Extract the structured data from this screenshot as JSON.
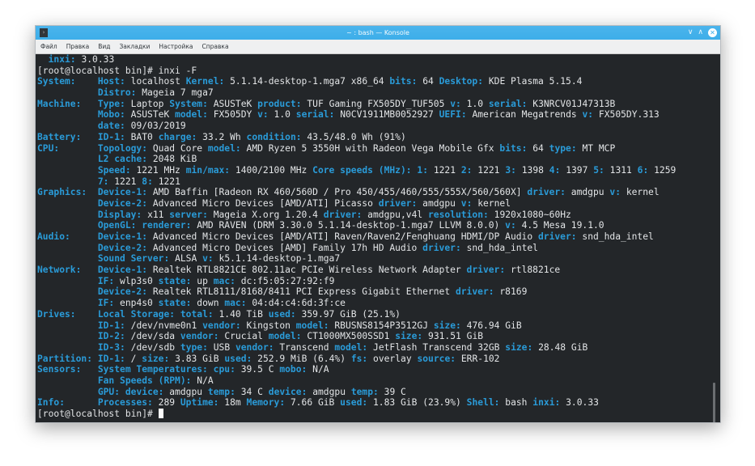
{
  "window": {
    "title": "~ : bash — Konsole",
    "app_icon": "terminal-icon"
  },
  "titlebar_buttons": {
    "minimize": "∨",
    "maximize": "∧",
    "close": "✕"
  },
  "menu": [
    "Файл",
    "Правка",
    "Вид",
    "Закладки",
    "Настройка",
    "Справка"
  ],
  "colors": {
    "key": "#2a9bd8",
    "text": "#e3e5e7",
    "background": "#232629",
    "titlebar": "#3daee9"
  },
  "terminal": {
    "lines": [
      {
        "indent": "  ",
        "parts": [
          {
            "k": "inxi:",
            "v": "3.0.33"
          }
        ]
      },
      {
        "plain": "[root@localhost bin]# inxi -F"
      },
      {
        "section": "System:",
        "parts": [
          {
            "k": "Host:",
            "v": "localhost"
          },
          {
            "k": "Kernel:",
            "v": "5.1.14-desktop-1.mga7 x86_64"
          },
          {
            "k": "bits:",
            "v": "64"
          },
          {
            "k": "Desktop:",
            "v": "KDE Plasma 5.15.4"
          }
        ]
      },
      {
        "parts": [
          {
            "k": "Distro:",
            "v": "Mageia 7 mga7"
          }
        ]
      },
      {
        "section": "Machine:",
        "parts": [
          {
            "k": "Type:",
            "v": "Laptop"
          },
          {
            "k": "System:",
            "v": "ASUSTeK"
          },
          {
            "k": "product:",
            "v": "TUF Gaming FX505DY_TUF505"
          },
          {
            "k": "v:",
            "v": "1.0"
          },
          {
            "k": "serial:",
            "v": "K3NRCV01J47313B"
          }
        ]
      },
      {
        "parts": [
          {
            "k": "Mobo:",
            "v": "ASUSTeK"
          },
          {
            "k": "model:",
            "v": "FX505DY"
          },
          {
            "k": "v:",
            "v": "1.0"
          },
          {
            "k": "serial:",
            "v": "N0CV1911MB0052927"
          },
          {
            "k": "UEFI:",
            "v": "American Megatrends"
          },
          {
            "k": "v:",
            "v": "FX505DY.313"
          }
        ]
      },
      {
        "parts": [
          {
            "k": "date:",
            "v": "09/03/2019"
          }
        ]
      },
      {
        "section": "Battery:",
        "parts": [
          {
            "k": "ID-1:",
            "v": "BAT0"
          },
          {
            "k": "charge:",
            "v": "33.2 Wh"
          },
          {
            "k": "condition:",
            "v": "43.5/48.0 Wh (91%)"
          }
        ]
      },
      {
        "section": "CPU:",
        "parts": [
          {
            "k": "Topology:",
            "v": "Quad Core"
          },
          {
            "k": "model:",
            "v": "AMD Ryzen 5 3550H with Radeon Vega Mobile Gfx"
          },
          {
            "k": "bits:",
            "v": "64"
          },
          {
            "k": "type:",
            "v": "MT MCP"
          }
        ]
      },
      {
        "parts": [
          {
            "k": "L2 cache:",
            "v": "2048 KiB"
          }
        ]
      },
      {
        "parts": [
          {
            "k": "Speed:",
            "v": "1221 MHz"
          },
          {
            "k": "min/max:",
            "v": "1400/2100 MHz"
          },
          {
            "k": "Core speeds (MHz):",
            "v": ""
          },
          {
            "k": "1:",
            "v": "1221"
          },
          {
            "k": "2:",
            "v": "1221"
          },
          {
            "k": "3:",
            "v": "1398"
          },
          {
            "k": "4:",
            "v": "1397"
          },
          {
            "k": "5:",
            "v": "1311"
          },
          {
            "k": "6:",
            "v": "1259"
          }
        ]
      },
      {
        "parts": [
          {
            "k": "7:",
            "v": "1221"
          },
          {
            "k": "8:",
            "v": "1221"
          }
        ]
      },
      {
        "section": "Graphics:",
        "parts": [
          {
            "k": "Device-1:",
            "v": "AMD Baffin [Radeon RX 460/560D / Pro 450/455/460/555/555X/560/560X]"
          },
          {
            "k": "driver:",
            "v": "amdgpu"
          },
          {
            "k": "v:",
            "v": "kernel"
          }
        ]
      },
      {
        "parts": [
          {
            "k": "Device-2:",
            "v": "Advanced Micro Devices [AMD/ATI] Picasso"
          },
          {
            "k": "driver:",
            "v": "amdgpu"
          },
          {
            "k": "v:",
            "v": "kernel"
          }
        ]
      },
      {
        "parts": [
          {
            "k": "Display:",
            "v": "x11"
          },
          {
            "k": "server:",
            "v": "Mageia X.org 1.20.4"
          },
          {
            "k": "driver:",
            "v": "amdgpu,v4l"
          },
          {
            "k": "resolution:",
            "v": "1920x1080~60Hz"
          }
        ]
      },
      {
        "parts": [
          {
            "k": "OpenGL:",
            "v": ""
          },
          {
            "k": "renderer:",
            "v": "AMD RAVEN (DRM 3.30.0 5.1.14-desktop-1.mga7 LLVM 8.0.0)"
          },
          {
            "k": "v:",
            "v": "4.5 Mesa 19.1.0"
          }
        ]
      },
      {
        "section": "Audio:",
        "parts": [
          {
            "k": "Device-1:",
            "v": "Advanced Micro Devices [AMD/ATI] Raven/Raven2/Fenghuang HDMI/DP Audio"
          },
          {
            "k": "driver:",
            "v": "snd_hda_intel"
          }
        ]
      },
      {
        "parts": [
          {
            "k": "Device-2:",
            "v": "Advanced Micro Devices [AMD] Family 17h HD Audio"
          },
          {
            "k": "driver:",
            "v": "snd_hda_intel"
          }
        ]
      },
      {
        "parts": [
          {
            "k": "Sound Server:",
            "v": "ALSA"
          },
          {
            "k": "v:",
            "v": "k5.1.14-desktop-1.mga7"
          }
        ]
      },
      {
        "section": "Network:",
        "parts": [
          {
            "k": "Device-1:",
            "v": "Realtek RTL8821CE 802.11ac PCIe Wireless Network Adapter"
          },
          {
            "k": "driver:",
            "v": "rtl8821ce"
          }
        ]
      },
      {
        "parts": [
          {
            "k": "IF:",
            "v": "wlp3s0"
          },
          {
            "k": "state:",
            "v": "up"
          },
          {
            "k": "mac:",
            "v": "dc:f5:05:27:92:f9"
          }
        ]
      },
      {
        "parts": [
          {
            "k": "Device-2:",
            "v": "Realtek RTL8111/8168/8411 PCI Express Gigabit Ethernet"
          },
          {
            "k": "driver:",
            "v": "r8169"
          }
        ]
      },
      {
        "parts": [
          {
            "k": "IF:",
            "v": "enp4s0"
          },
          {
            "k": "state:",
            "v": "down"
          },
          {
            "k": "mac:",
            "v": "04:d4:c4:6d:3f:ce"
          }
        ]
      },
      {
        "section": "Drives:",
        "parts": [
          {
            "k": "Local Storage:",
            "v": ""
          },
          {
            "k": "total:",
            "v": "1.40 TiB"
          },
          {
            "k": "used:",
            "v": "359.97 GiB (25.1%)"
          }
        ]
      },
      {
        "parts": [
          {
            "k": "ID-1:",
            "v": "/dev/nvme0n1"
          },
          {
            "k": "vendor:",
            "v": "Kingston"
          },
          {
            "k": "model:",
            "v": "RBUSNS8154P3512GJ"
          },
          {
            "k": "size:",
            "v": "476.94 GiB"
          }
        ]
      },
      {
        "parts": [
          {
            "k": "ID-2:",
            "v": "/dev/sda"
          },
          {
            "k": "vendor:",
            "v": "Crucial"
          },
          {
            "k": "model:",
            "v": "CT1000MX500SSD1"
          },
          {
            "k": "size:",
            "v": "931.51 GiB"
          }
        ]
      },
      {
        "parts": [
          {
            "k": "ID-3:",
            "v": "/dev/sdb"
          },
          {
            "k": "type:",
            "v": "USB"
          },
          {
            "k": "vendor:",
            "v": "Transcend"
          },
          {
            "k": "model:",
            "v": "JetFlash Transcend 32GB"
          },
          {
            "k": "size:",
            "v": "28.48 GiB"
          }
        ]
      },
      {
        "section": "Partition:",
        "parts": [
          {
            "k": "ID-1:",
            "v": "/"
          },
          {
            "k": "size:",
            "v": "3.83 GiB"
          },
          {
            "k": "used:",
            "v": "252.9 MiB (6.4%)"
          },
          {
            "k": "fs:",
            "v": "overlay"
          },
          {
            "k": "source:",
            "v": "ERR-102"
          }
        ]
      },
      {
        "section": "Sensors:",
        "parts": [
          {
            "k": "System Temperatures:",
            "v": ""
          },
          {
            "k": "cpu:",
            "v": "39.5 C"
          },
          {
            "k": "mobo:",
            "v": "N/A"
          }
        ]
      },
      {
        "parts": [
          {
            "k": "Fan Speeds (RPM):",
            "v": "N/A"
          }
        ]
      },
      {
        "parts": [
          {
            "k": "GPU:",
            "v": ""
          },
          {
            "k": "device:",
            "v": "amdgpu"
          },
          {
            "k": "temp:",
            "v": "34 C"
          },
          {
            "k": "device:",
            "v": "amdgpu"
          },
          {
            "k": "temp:",
            "v": "39 C"
          }
        ]
      },
      {
        "section": "Info:",
        "parts": [
          {
            "k": "Processes:",
            "v": "289"
          },
          {
            "k": "Uptime:",
            "v": "18m"
          },
          {
            "k": "Memory:",
            "v": "7.66 GiB"
          },
          {
            "k": "used:",
            "v": "1.83 GiB (23.9%)"
          },
          {
            "k": "Shell:",
            "v": "bash"
          },
          {
            "k": "inxi:",
            "v": "3.0.33"
          }
        ]
      },
      {
        "plain": "[root@localhost bin]# ",
        "cursor": true
      }
    ]
  }
}
